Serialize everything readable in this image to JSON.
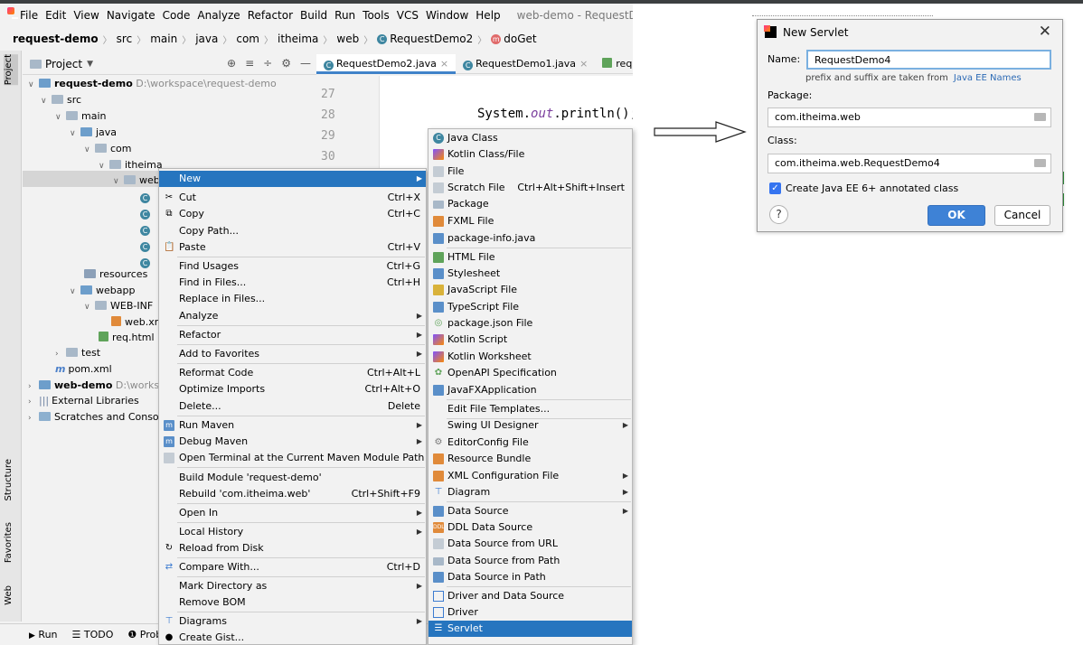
{
  "window": {
    "title": "web-demo - RequestDem",
    "menus": [
      "File",
      "Edit",
      "View",
      "Navigate",
      "Code",
      "Analyze",
      "Refactor",
      "Build",
      "Run",
      "Tools",
      "VCS",
      "Window",
      "Help"
    ]
  },
  "breadcrumb": [
    "request-demo",
    "src",
    "main",
    "java",
    "com",
    "itheima",
    "web",
    "RequestDemo2",
    "doGet"
  ],
  "tool_strip": {
    "project": "Project",
    "structure": "Structure",
    "favorites": "Favorites",
    "web": "Web"
  },
  "project_panel": {
    "title": "Project",
    "tree": [
      {
        "label": "request-demo",
        "path": "D:\\workspace\\request-demo"
      },
      {
        "label": "src"
      },
      {
        "label": "main"
      },
      {
        "label": "java"
      },
      {
        "label": "com"
      },
      {
        "label": "itheima"
      },
      {
        "label": "web"
      },
      {
        "label": "resources"
      },
      {
        "label": "webapp"
      },
      {
        "label": "WEB-INF"
      },
      {
        "label": "web.xm"
      },
      {
        "label": "req.html"
      },
      {
        "label": "test"
      },
      {
        "label": "pom.xml"
      },
      {
        "label": "web-demo",
        "path": "D:\\worksp"
      },
      {
        "label": "External Libraries"
      },
      {
        "label": "Scratches and Console"
      }
    ]
  },
  "editor": {
    "tabs": [
      "RequestDemo2.java",
      "RequestDemo1.java",
      "req.htm"
    ],
    "line_numbers": [
      "27",
      "28",
      "29",
      "30"
    ],
    "code_prefix": "System.",
    "code_field": "out",
    "code_suffix": ".println();"
  },
  "bottom_bar": {
    "run": "Run",
    "todo": "TODO",
    "problems": "Probl"
  },
  "context_menu": [
    {
      "label": "New",
      "shortcut": ""
    },
    {
      "label": "Cut",
      "shortcut": "Ctrl+X"
    },
    {
      "label": "Copy",
      "shortcut": "Ctrl+C"
    },
    {
      "label": "Copy Path...",
      "shortcut": ""
    },
    {
      "label": "Paste",
      "shortcut": "Ctrl+V"
    },
    {
      "label": "Find Usages",
      "shortcut": "Ctrl+G"
    },
    {
      "label": "Find in Files...",
      "shortcut": "Ctrl+H"
    },
    {
      "label": "Replace in Files...",
      "shortcut": ""
    },
    {
      "label": "Analyze",
      "shortcut": ""
    },
    {
      "label": "Refactor",
      "shortcut": ""
    },
    {
      "label": "Add to Favorites",
      "shortcut": ""
    },
    {
      "label": "Reformat Code",
      "shortcut": "Ctrl+Alt+L"
    },
    {
      "label": "Optimize Imports",
      "shortcut": "Ctrl+Alt+O"
    },
    {
      "label": "Delete...",
      "shortcut": "Delete"
    },
    {
      "label": "Run Maven",
      "shortcut": ""
    },
    {
      "label": "Debug Maven",
      "shortcut": ""
    },
    {
      "label": "Open Terminal at the Current Maven Module Path",
      "shortcut": ""
    },
    {
      "label": "Build Module 'request-demo'",
      "shortcut": ""
    },
    {
      "label": "Rebuild 'com.itheima.web'",
      "shortcut": "Ctrl+Shift+F9"
    },
    {
      "label": "Open In",
      "shortcut": ""
    },
    {
      "label": "Local History",
      "shortcut": ""
    },
    {
      "label": "Reload from Disk",
      "shortcut": ""
    },
    {
      "label": "Compare With...",
      "shortcut": "Ctrl+D"
    },
    {
      "label": "Mark Directory as",
      "shortcut": ""
    },
    {
      "label": "Remove BOM",
      "shortcut": ""
    },
    {
      "label": "Diagrams",
      "shortcut": ""
    },
    {
      "label": "Create Gist...",
      "shortcut": ""
    }
  ],
  "new_submenu": [
    {
      "label": "Java Class",
      "shortcut": ""
    },
    {
      "label": "Kotlin Class/File",
      "shortcut": ""
    },
    {
      "label": "File",
      "shortcut": ""
    },
    {
      "label": "Scratch File",
      "shortcut": "Ctrl+Alt+Shift+Insert"
    },
    {
      "label": "Package",
      "shortcut": ""
    },
    {
      "label": "FXML File",
      "shortcut": ""
    },
    {
      "label": "package-info.java",
      "shortcut": ""
    },
    {
      "label": "HTML File",
      "shortcut": ""
    },
    {
      "label": "Stylesheet",
      "shortcut": ""
    },
    {
      "label": "JavaScript File",
      "shortcut": ""
    },
    {
      "label": "TypeScript File",
      "shortcut": ""
    },
    {
      "label": "package.json File",
      "shortcut": ""
    },
    {
      "label": "Kotlin Script",
      "shortcut": ""
    },
    {
      "label": "Kotlin Worksheet",
      "shortcut": ""
    },
    {
      "label": "OpenAPI Specification",
      "shortcut": ""
    },
    {
      "label": "JavaFXApplication",
      "shortcut": ""
    },
    {
      "label": "Edit File Templates...",
      "shortcut": ""
    },
    {
      "label": "Swing UI Designer",
      "shortcut": ""
    },
    {
      "label": "EditorConfig File",
      "shortcut": ""
    },
    {
      "label": "Resource Bundle",
      "shortcut": ""
    },
    {
      "label": "XML Configuration File",
      "shortcut": ""
    },
    {
      "label": "Diagram",
      "shortcut": ""
    },
    {
      "label": "Data Source",
      "shortcut": ""
    },
    {
      "label": "DDL Data Source",
      "shortcut": ""
    },
    {
      "label": "Data Source from URL",
      "shortcut": ""
    },
    {
      "label": "Data Source from Path",
      "shortcut": ""
    },
    {
      "label": "Data Source in Path",
      "shortcut": ""
    },
    {
      "label": "Driver and Data Source",
      "shortcut": ""
    },
    {
      "label": "Driver",
      "shortcut": ""
    },
    {
      "label": "Servlet",
      "shortcut": ""
    }
  ],
  "dialog": {
    "title": "New Servlet",
    "name_label": "Name:",
    "name_value": "RequestDemo4",
    "hint": "prefix and suffix are taken from",
    "hint_link": "Java EE Names",
    "package_label": "Package:",
    "package_value": "com.itheima.web",
    "class_label": "Class:",
    "class_value": "com.itheima.web.RequestDemo4",
    "checkbox_label": "Create Java EE 6+ annotated class",
    "ok": "OK",
    "cancel": "Cancel",
    "help": "?"
  },
  "colors": {
    "selection": "#2675bf",
    "accent_button": "#3e82d6",
    "link": "#2e6bb5"
  }
}
